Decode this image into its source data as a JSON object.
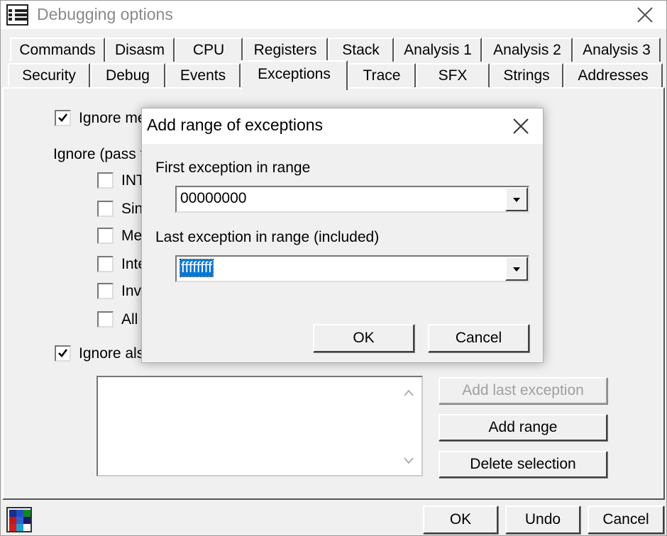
{
  "window": {
    "title": "Debugging options",
    "icon": "list-icon",
    "close_icon": "close-icon"
  },
  "tabs": {
    "row1": [
      "Commands",
      "Disasm",
      "CPU",
      "Registers",
      "Stack",
      "Analysis 1",
      "Analysis 2",
      "Analysis 3"
    ],
    "row2": [
      "Security",
      "Debug",
      "Events",
      "Exceptions",
      "Trace",
      "SFX",
      "Strings",
      "Addresses"
    ],
    "active": "Exceptions"
  },
  "exceptions_panel": {
    "ignore_memory_label": "Ignore me",
    "ignore_memory_checked": true,
    "ignore_pass_label": "Ignore (pass t",
    "sub_options": [
      {
        "label": "INT",
        "checked": false
      },
      {
        "label": "Sin",
        "checked": false
      },
      {
        "label": "Me",
        "checked": false
      },
      {
        "label": "Inte",
        "checked": false
      },
      {
        "label": "Inv",
        "checked": false
      },
      {
        "label": "All",
        "checked": false
      }
    ],
    "ignore_also_label": "Ignore als",
    "ignore_also_checked": true,
    "buttons": {
      "add_last_exception": "Add last exception",
      "add_range": "Add range",
      "delete_selection": "Delete selection"
    }
  },
  "footer": {
    "ok": "OK",
    "undo": "Undo",
    "cancel": "Cancel"
  },
  "dialog": {
    "title": "Add range of exceptions",
    "first_label": "First exception in range",
    "first_value": "00000000",
    "last_label": "Last exception in range (included)",
    "last_value": "ffffffff",
    "ok": "OK",
    "cancel": "Cancel"
  },
  "colors": {
    "selection": "#0078d7",
    "disabled_text": "#a0a0a0",
    "window_bg": "#f0f0f0"
  }
}
